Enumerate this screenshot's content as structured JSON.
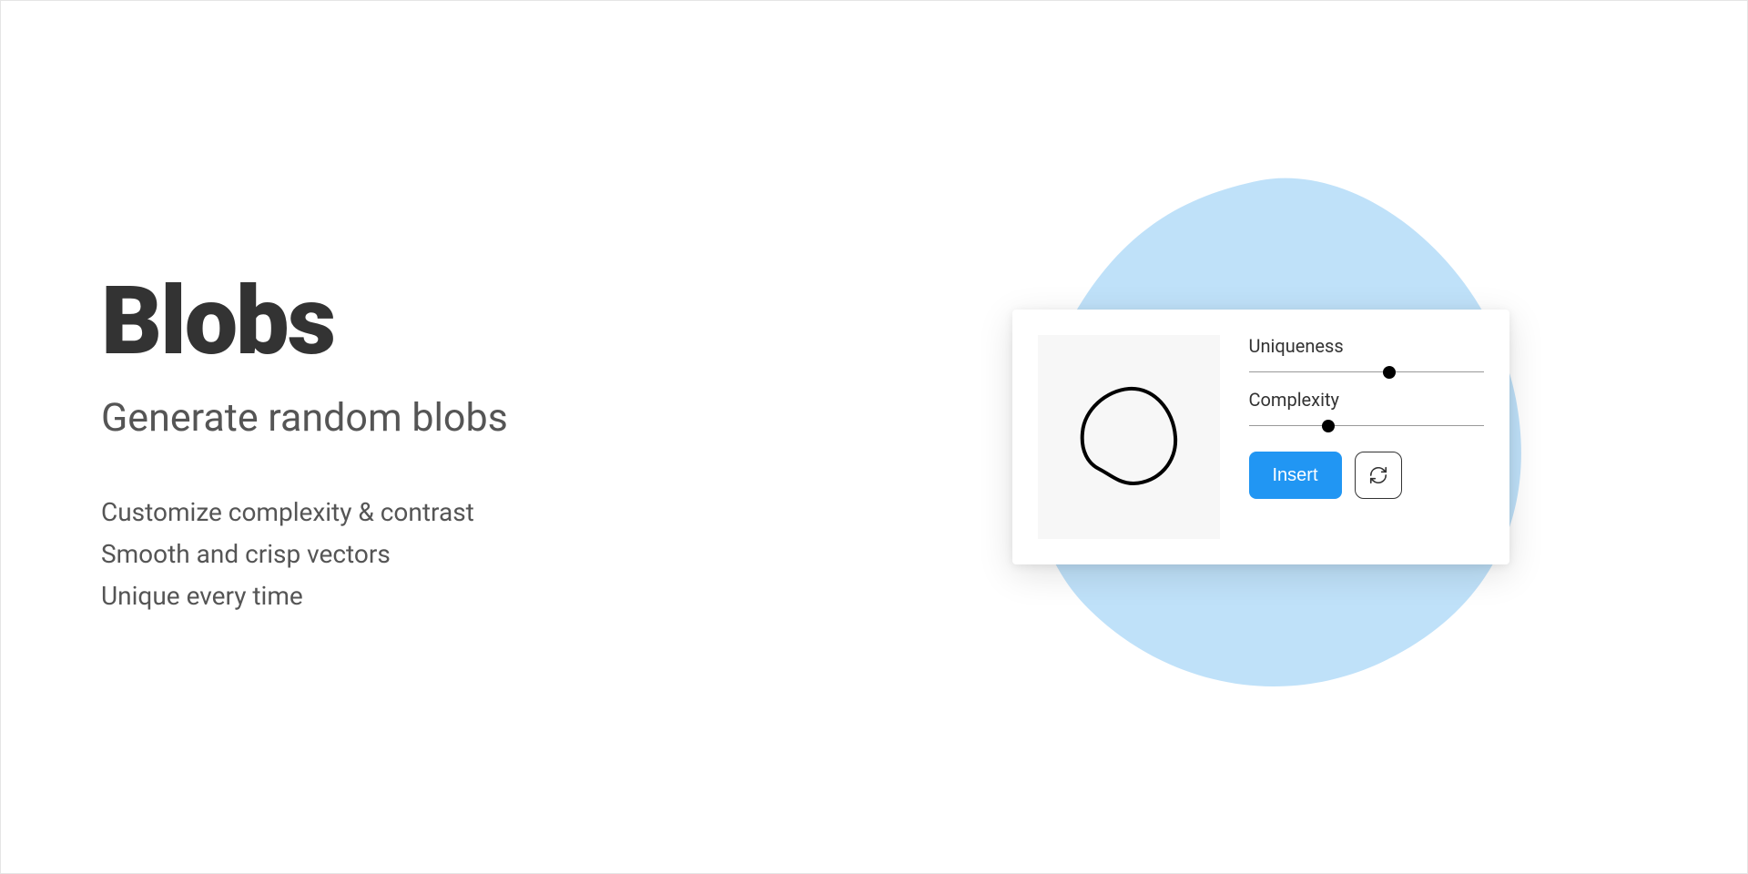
{
  "hero": {
    "title": "Blobs",
    "subtitle": "Generate random blobs",
    "features": [
      "Customize complexity & contrast",
      "Smooth and crisp vectors",
      "Unique every time"
    ]
  },
  "widget": {
    "sliders": {
      "uniqueness": {
        "label": "Uniqueness",
        "value_percent": 60
      },
      "complexity": {
        "label": "Complexity",
        "value_percent": 34
      }
    },
    "insert_label": "Insert",
    "refresh_icon": "refresh-icon"
  },
  "colors": {
    "accent_blue": "#2196F3",
    "bg_blob": "#bfe1f9",
    "text_dark": "#333333",
    "text_mid": "#555555"
  }
}
